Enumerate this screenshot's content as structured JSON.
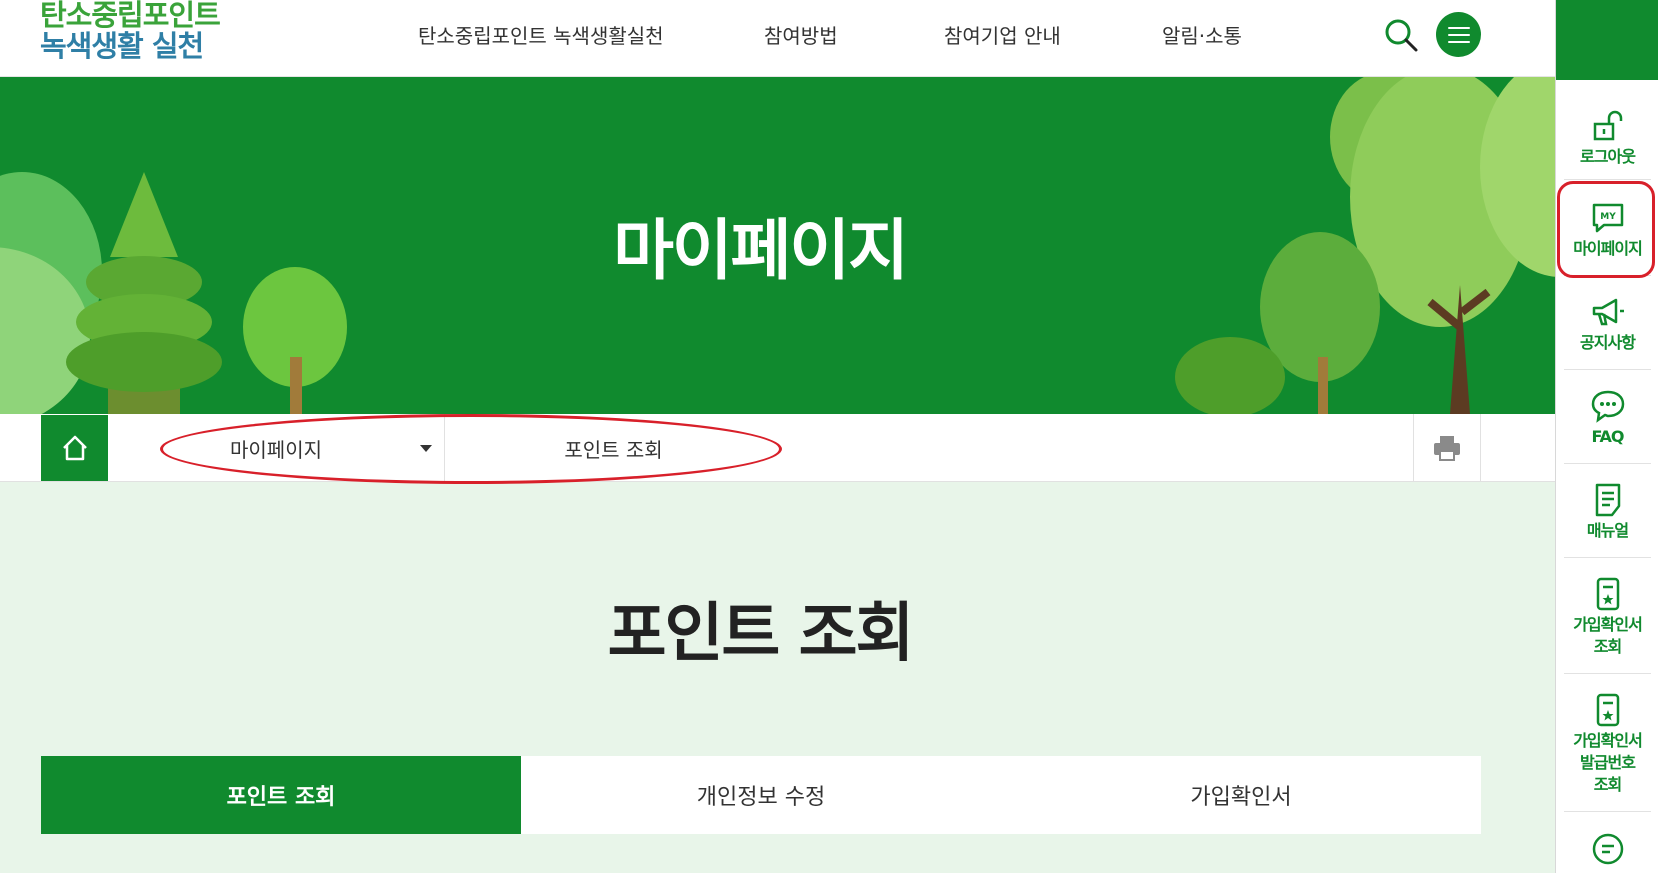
{
  "header": {
    "logo_line1": "탄소중립포인트",
    "logo_line2": "녹색생활 실천",
    "nav": [
      {
        "label": "탄소중립포인트 녹색생활실천"
      },
      {
        "label": "참여방법"
      },
      {
        "label": "참여기업 안내"
      },
      {
        "label": "알림·소통"
      }
    ],
    "search_icon": "search-icon",
    "menu_icon": "hamburger-icon"
  },
  "banner": {
    "title": "마이페이지"
  },
  "breadcrumb": {
    "home_icon": "home-icon",
    "section": "마이페이지",
    "current": "포인트 조회",
    "print_icon": "printer-icon"
  },
  "main": {
    "heading": "포인트 조회",
    "tabs": [
      {
        "label": "포인트 조회",
        "active": true
      },
      {
        "label": "개인정보 수정",
        "active": false
      },
      {
        "label": "가입확인서",
        "active": false
      }
    ]
  },
  "quick_menu": [
    {
      "label": "로그아웃",
      "icon": "unlock-icon"
    },
    {
      "label": "마이페이지",
      "icon": "my-page-icon"
    },
    {
      "label": "공지사항",
      "icon": "megaphone-icon"
    },
    {
      "label": "FAQ",
      "icon": "chat-bubble-icon"
    },
    {
      "label": "매뉴얼",
      "icon": "document-icon"
    },
    {
      "label": "가입확인서\n조회",
      "icon": "certificate-icon"
    },
    {
      "label": "가입확인서\n발급번호\n조회",
      "icon": "certificate-number-icon"
    }
  ],
  "colors": {
    "brand_green": "#108a2e",
    "page_bg": "#e8f5e9",
    "annotation_red": "#d8202a",
    "logo_green": "#3aa33a",
    "logo_blue": "#2f7fa6"
  }
}
